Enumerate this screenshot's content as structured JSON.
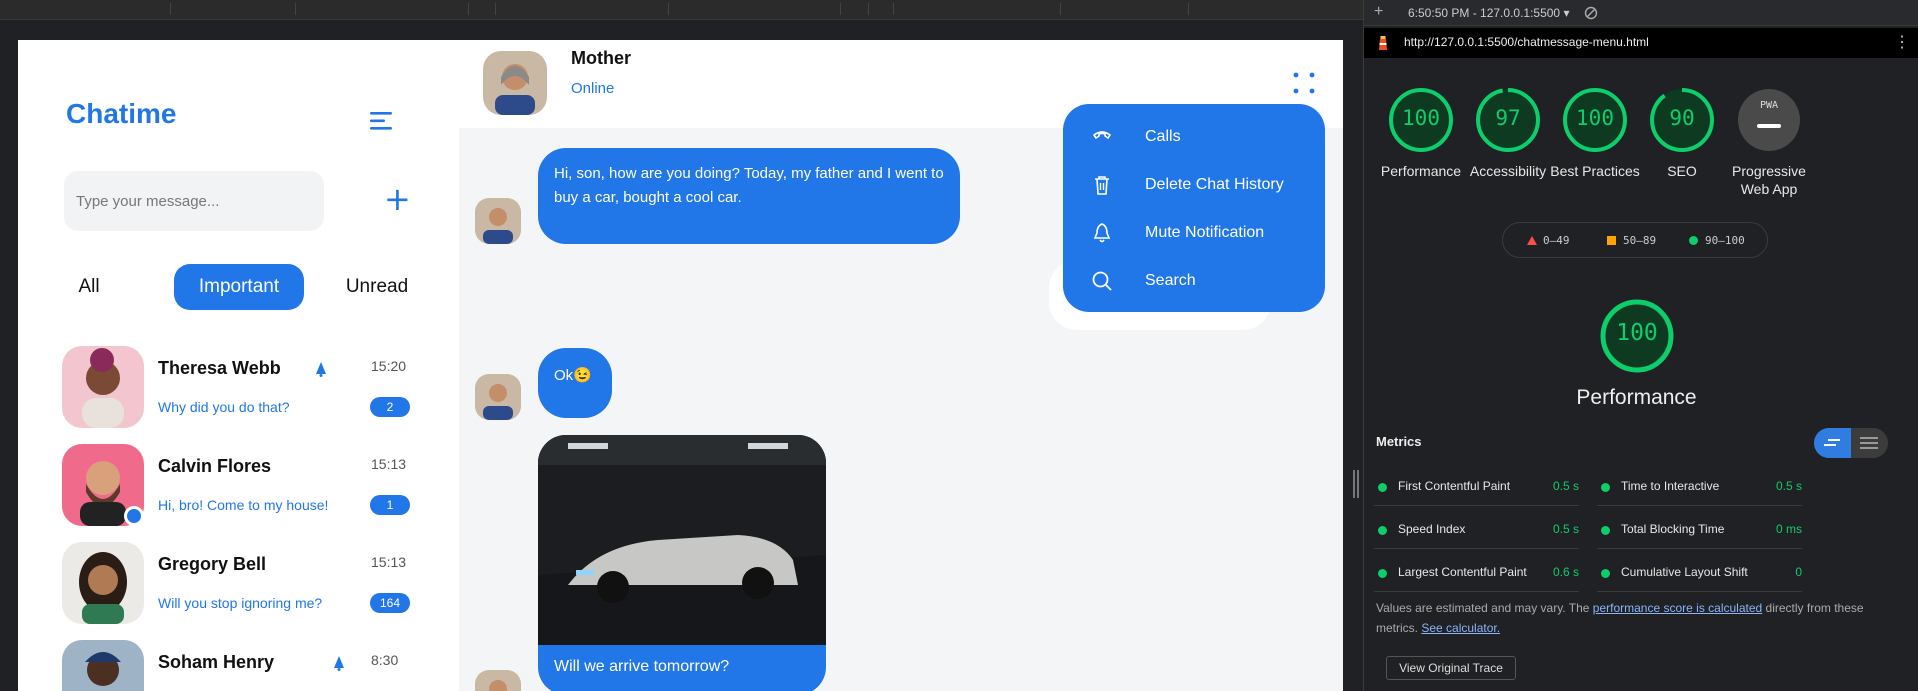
{
  "app": {
    "brand": "Chatime",
    "search_placeholder": "Type your message...",
    "filters": [
      "All",
      "Important",
      "Unread"
    ],
    "active_filter": "Important",
    "contacts": [
      {
        "name": "Theresa Webb",
        "message": "Why did you do that?",
        "time": "15:20",
        "badge": "2",
        "bell": true
      },
      {
        "name": "Calvin Flores",
        "message": "Hi, bro! Come to my house!",
        "time": "15:13",
        "badge": "1",
        "online": true
      },
      {
        "name": "Gregory Bell",
        "message": "Will you stop ignoring me?",
        "time": "15:13",
        "badge": "164"
      },
      {
        "name": "Soham Henry",
        "message": "",
        "time": "8:30",
        "badge": "",
        "bell": true
      }
    ]
  },
  "chat": {
    "name": "Mother",
    "status": "Online",
    "messages": [
      {
        "text": "Hi, son, how are you doing? Today, my father and I went to buy a car, bought a cool car."
      },
      {
        "text": "Ok😉"
      },
      {
        "caption": "Will we arrive tomorrow?",
        "image": "car-photo"
      }
    ],
    "menu": [
      {
        "label": "Calls",
        "icon": "phone-icon"
      },
      {
        "label": "Delete Chat History",
        "icon": "trash-icon"
      },
      {
        "label": "Mute Notification",
        "icon": "bell-icon"
      },
      {
        "label": "Search",
        "icon": "search-icon"
      }
    ]
  },
  "devtools": {
    "session": "6:50:50 PM - 127.0.0.1:5500 ▾",
    "url": "http://127.0.0.1:5500/chatmessage-menu.html",
    "scores": [
      {
        "label": "Performance",
        "value": "100",
        "fraction": 1.0
      },
      {
        "label": "Accessibility",
        "value": "97",
        "fraction": 0.97
      },
      {
        "label": "Best Practices",
        "value": "100",
        "fraction": 1.0
      },
      {
        "label": "SEO",
        "value": "90",
        "fraction": 0.9
      },
      {
        "label": "Progressive Web App",
        "value": "PWA"
      }
    ],
    "legend": [
      "0–49",
      "50–89",
      "90–100"
    ],
    "main_score": "100",
    "main_label": "Performance",
    "metrics_title": "Metrics",
    "metrics": [
      {
        "name": "First Contentful Paint",
        "value": "0.5 s"
      },
      {
        "name": "Time to Interactive",
        "value": "0.5 s"
      },
      {
        "name": "Speed Index",
        "value": "0.5 s"
      },
      {
        "name": "Total Blocking Time",
        "value": "0 ms"
      },
      {
        "name": "Largest Contentful Paint",
        "value": "0.6 s"
      },
      {
        "name": "Cumulative Layout Shift",
        "value": "0"
      }
    ],
    "note_prefix": "Values are estimated and may vary. The ",
    "note_link1": "performance score is calculated",
    "note_middle": " directly from these metrics. ",
    "note_link2": "See calculator.",
    "trace_button": "View Original Trace"
  },
  "colors": {
    "accent": "#2176e8",
    "score_green": "#0cce6b",
    "devtools_bg": "#202124"
  }
}
